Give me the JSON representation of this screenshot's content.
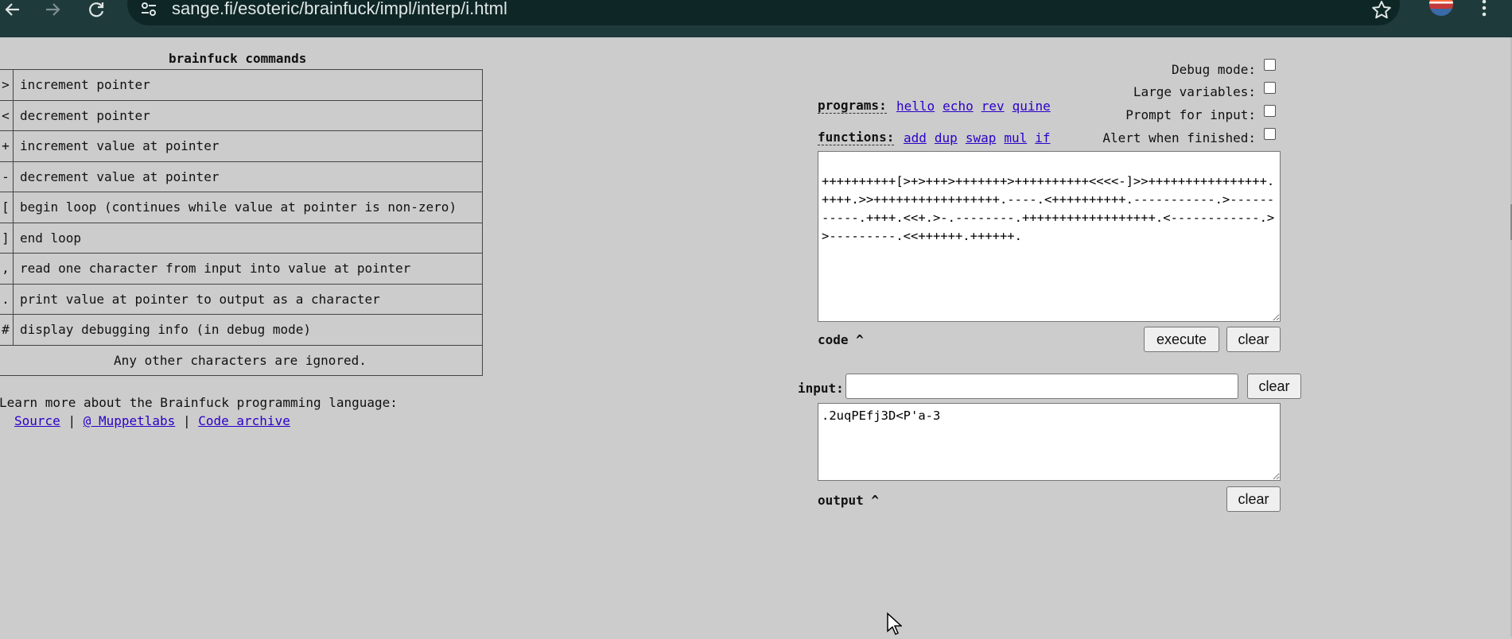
{
  "browser": {
    "url": "sange.fi/esoteric/brainfuck/impl/interp/i.html"
  },
  "commands": {
    "title": "brainfuck commands",
    "rows": [
      {
        "symbol": ">",
        "description": "increment pointer"
      },
      {
        "symbol": "<",
        "description": "decrement pointer"
      },
      {
        "symbol": "+",
        "description": "increment value at pointer"
      },
      {
        "symbol": "-",
        "description": "decrement value at pointer"
      },
      {
        "symbol": "[",
        "description": "begin loop (continues while value at pointer is non-zero)"
      },
      {
        "symbol": "]",
        "description": "end loop"
      },
      {
        "symbol": ",",
        "description": "read one character from input into value at pointer"
      },
      {
        "symbol": ".",
        "description": "print value at pointer to output as a character"
      },
      {
        "symbol": "#",
        "description": "display debugging info (in debug mode)"
      }
    ],
    "footer": "Any other characters are ignored."
  },
  "learn_more": {
    "text": "Learn more about the Brainfuck programming language:",
    "links": [
      "Source",
      "@ Muppetlabs",
      "Code archive"
    ],
    "separator": "|"
  },
  "options": [
    {
      "label": "Debug mode:",
      "checked": false
    },
    {
      "label": "Large variables:",
      "checked": false
    },
    {
      "label": "Prompt for input:",
      "checked": false
    },
    {
      "label": "Alert when finished:",
      "checked": false
    }
  ],
  "programs": {
    "label": "programs:",
    "items": [
      "hello",
      "echo",
      "rev",
      "quine"
    ]
  },
  "functions": {
    "label": "functions:",
    "items": [
      "add",
      "dup",
      "swap",
      "mul",
      "if"
    ]
  },
  "code": {
    "value": "++++++++++[>+>+++>+++++++>++++++++++<<<<-]>>++++++++++++++++.++++.>>+++++++++++++++++.----.<++++++++++.-----------.>-----------.++++.<<+.>-.--------.++++++++++++++++++.<------------.>>---------.<<++++++.++++++.",
    "label": "code ^",
    "execute_label": "execute",
    "clear_label": "clear"
  },
  "input": {
    "label": "input:",
    "value": "",
    "clear_label": "clear"
  },
  "output": {
    "value": ".2uqPEfj3D<P'a-3",
    "label": "output ^",
    "clear_label": "clear"
  },
  "icons": {
    "back": "arrow-left-icon",
    "forward": "arrow-right-icon",
    "reload": "reload-icon",
    "site_info": "tune-icon",
    "bookmark": "star-icon",
    "profile": "avatar",
    "menu": "kebab-menu-icon",
    "pointer": "mouse-cursor-icon"
  }
}
